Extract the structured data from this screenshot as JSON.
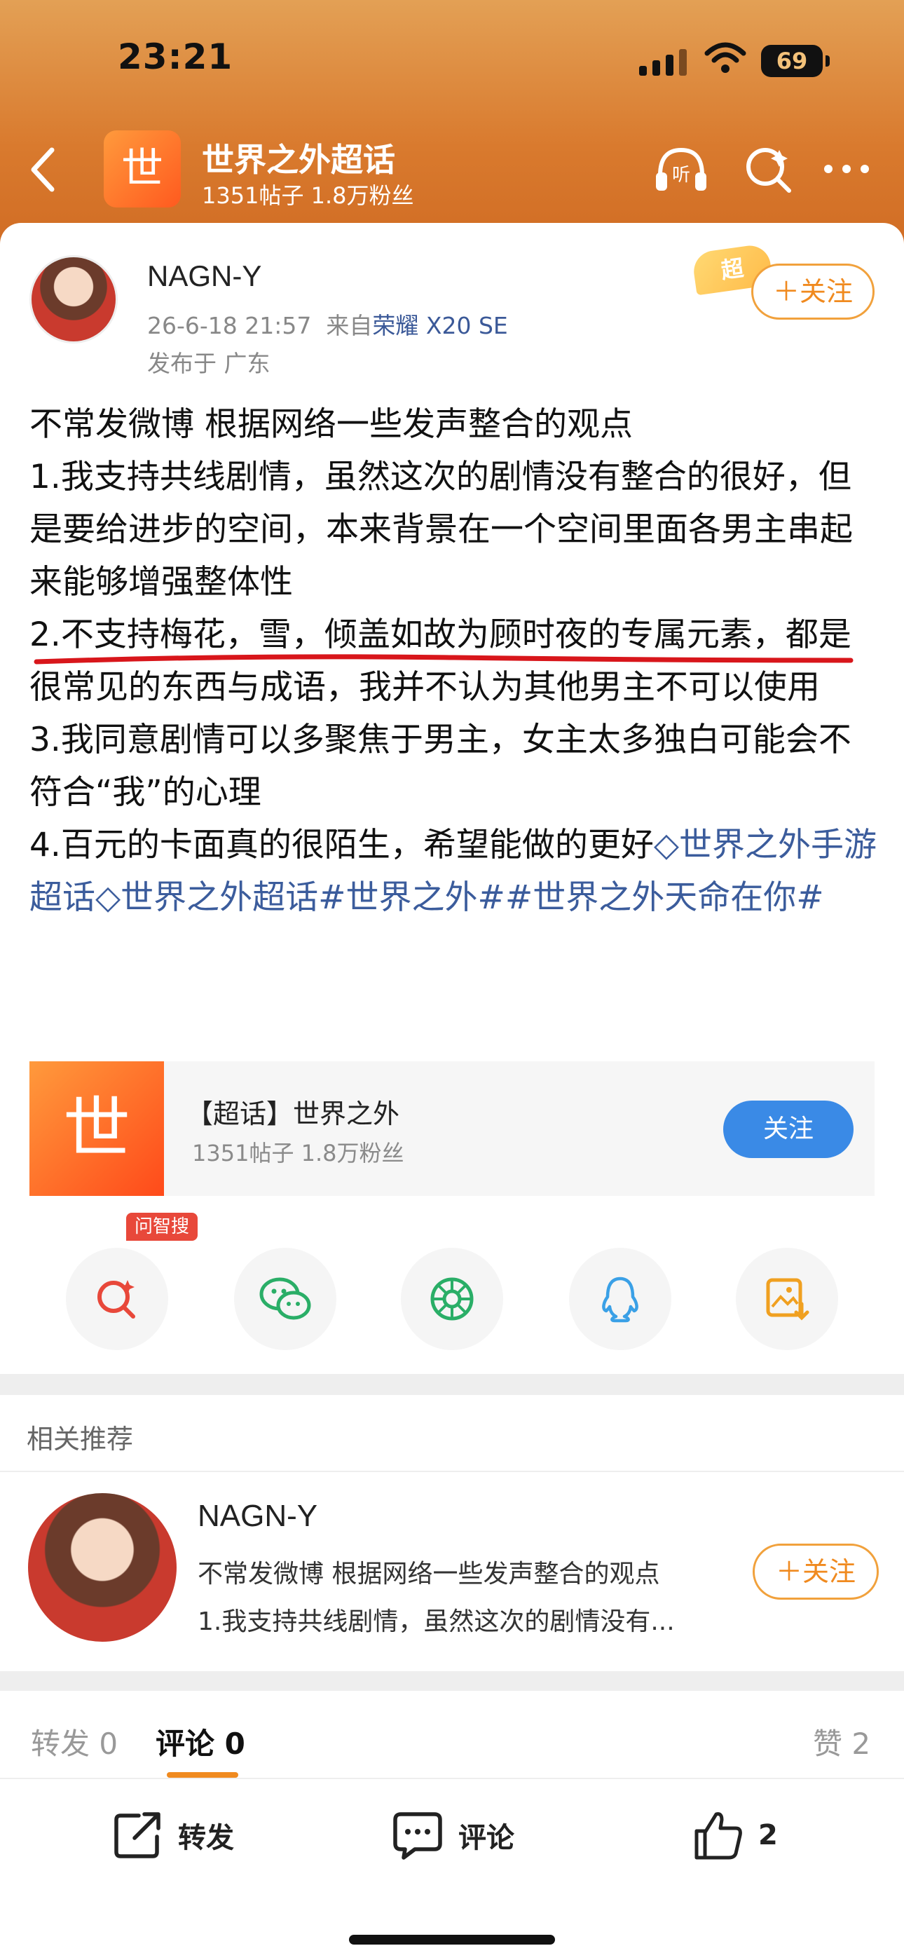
{
  "status_bar": {
    "time": "23:21",
    "battery": "69"
  },
  "nav": {
    "topic_logo_char": "世",
    "title": "世界之外超话",
    "stats": "1351帖子 1.8万粉丝"
  },
  "post": {
    "username": "NAGN-Y",
    "date": "26-6-18 21:57",
    "source_prefix": "来自",
    "device": "荣耀 X20 SE",
    "location": "发布于 广东",
    "super_badge": "超",
    "follow_label": "＋关注",
    "lines": {
      "l1": "不常发微博 根据网络一些发声整合的观点",
      "l2": "1.我支持共线剧情，虽然这次的剧情没有整合的很好，但是要给进步的空间，本来背景在一个空间里面各男主串起来能够增强整体性",
      "l3": "2.不支持梅花，雪，倾盖如故为顾时夜的专属元素，都是很常见的东西与成语，我并不认为其他男主不可以使用",
      "l4": "3.我同意剧情可以多聚焦于男主，女主太多独白可能会不符合“我”的心理",
      "l5": "4.百元的卡面真的很陌生，希望能做的更好"
    },
    "links": {
      "topic1": "世界之外手游超话",
      "topic2": "世界之外超话",
      "tag1": "#世界之外#",
      "tag2": "#世界之外天命在你#"
    }
  },
  "topic_card": {
    "logo_char": "世",
    "title": "【超话】世界之外",
    "stats": "1351帖子 1.8万粉丝",
    "follow_label": "关注"
  },
  "share": {
    "ai_tag": "问智搜",
    "items": [
      "search-ai",
      "wechat",
      "moments",
      "qq",
      "save-image"
    ]
  },
  "related": {
    "header": "相关推荐",
    "name": "NAGN-Y",
    "line1": "不常发微博 根据网络一些发声整合的观点",
    "line2": "1.我支持共线剧情，虽然这次的剧情没有...",
    "follow_label": "＋关注"
  },
  "tabs": {
    "repost": "转发 0",
    "comment": "评论 0",
    "like": "赞 2"
  },
  "actions": {
    "repost": "转发",
    "comment": "评论",
    "like": "2"
  },
  "colors": {
    "header_orange": "#d97a2e",
    "link_blue": "#3b5c9c",
    "follow_orange": "#f08a1f",
    "topic_follow_blue": "#3a8ae6",
    "underline_red": "#d8161b"
  }
}
